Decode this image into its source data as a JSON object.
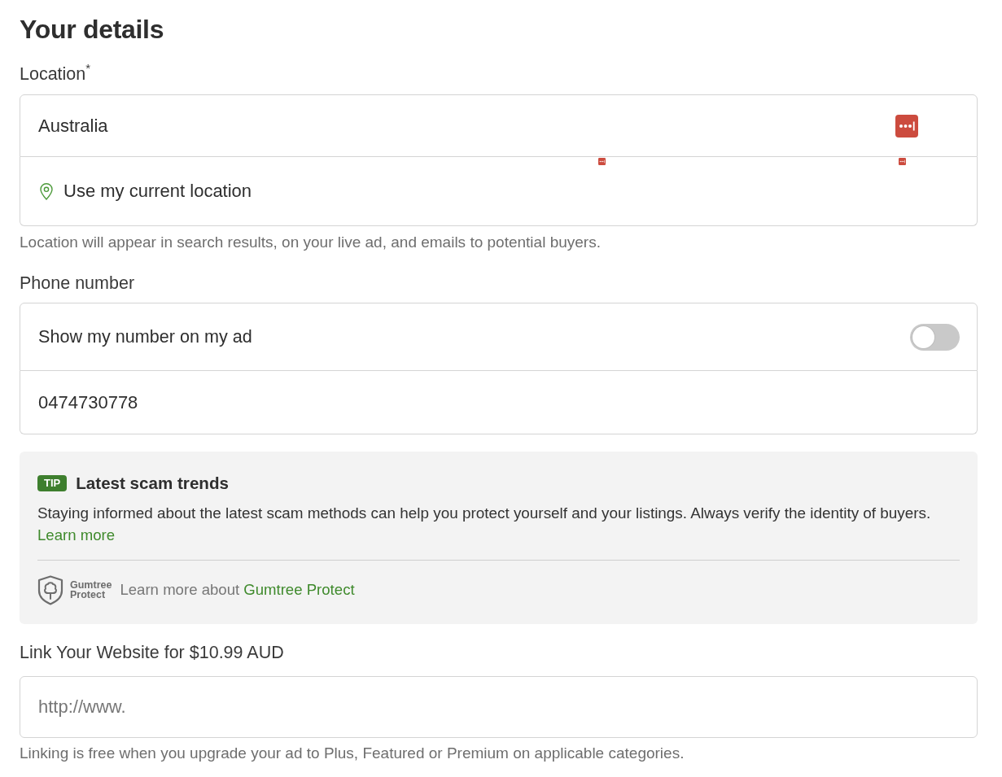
{
  "heading": "Your details",
  "location": {
    "label": "Location$^{*}$",
    "value": "Australia",
    "current_location": "Use my current location",
    "help": "Location will appear in search results, on your live ad, and emails to potential buyers."
  },
  "phone": {
    "label": "Phone number",
    "show_number": {
      "label": "Show my number on my ad",
      "on": false
    },
    "value": "0474730778"
  },
  "tip": {
    "badge": "TIP",
    "title": "Latest scam trends",
    "body": "Staying informed about the latest scam methods can help you protect yourself and your listings. Always verify the identity of buyers.",
    "link": "Learn more",
    "protect": {
      "logo_text": [
        "Gumtree",
        "Protect"
      ],
      "text": "Learn more about",
      "link": "Gumtree Protect"
    }
  },
  "website": {
    "label": "Link Your Website for $10.99 AUD",
    "placeholder": "http://www.",
    "help": "Linking is free when you upgrade your ad to Plus, Featured or Premium on applicable categories."
  }
}
